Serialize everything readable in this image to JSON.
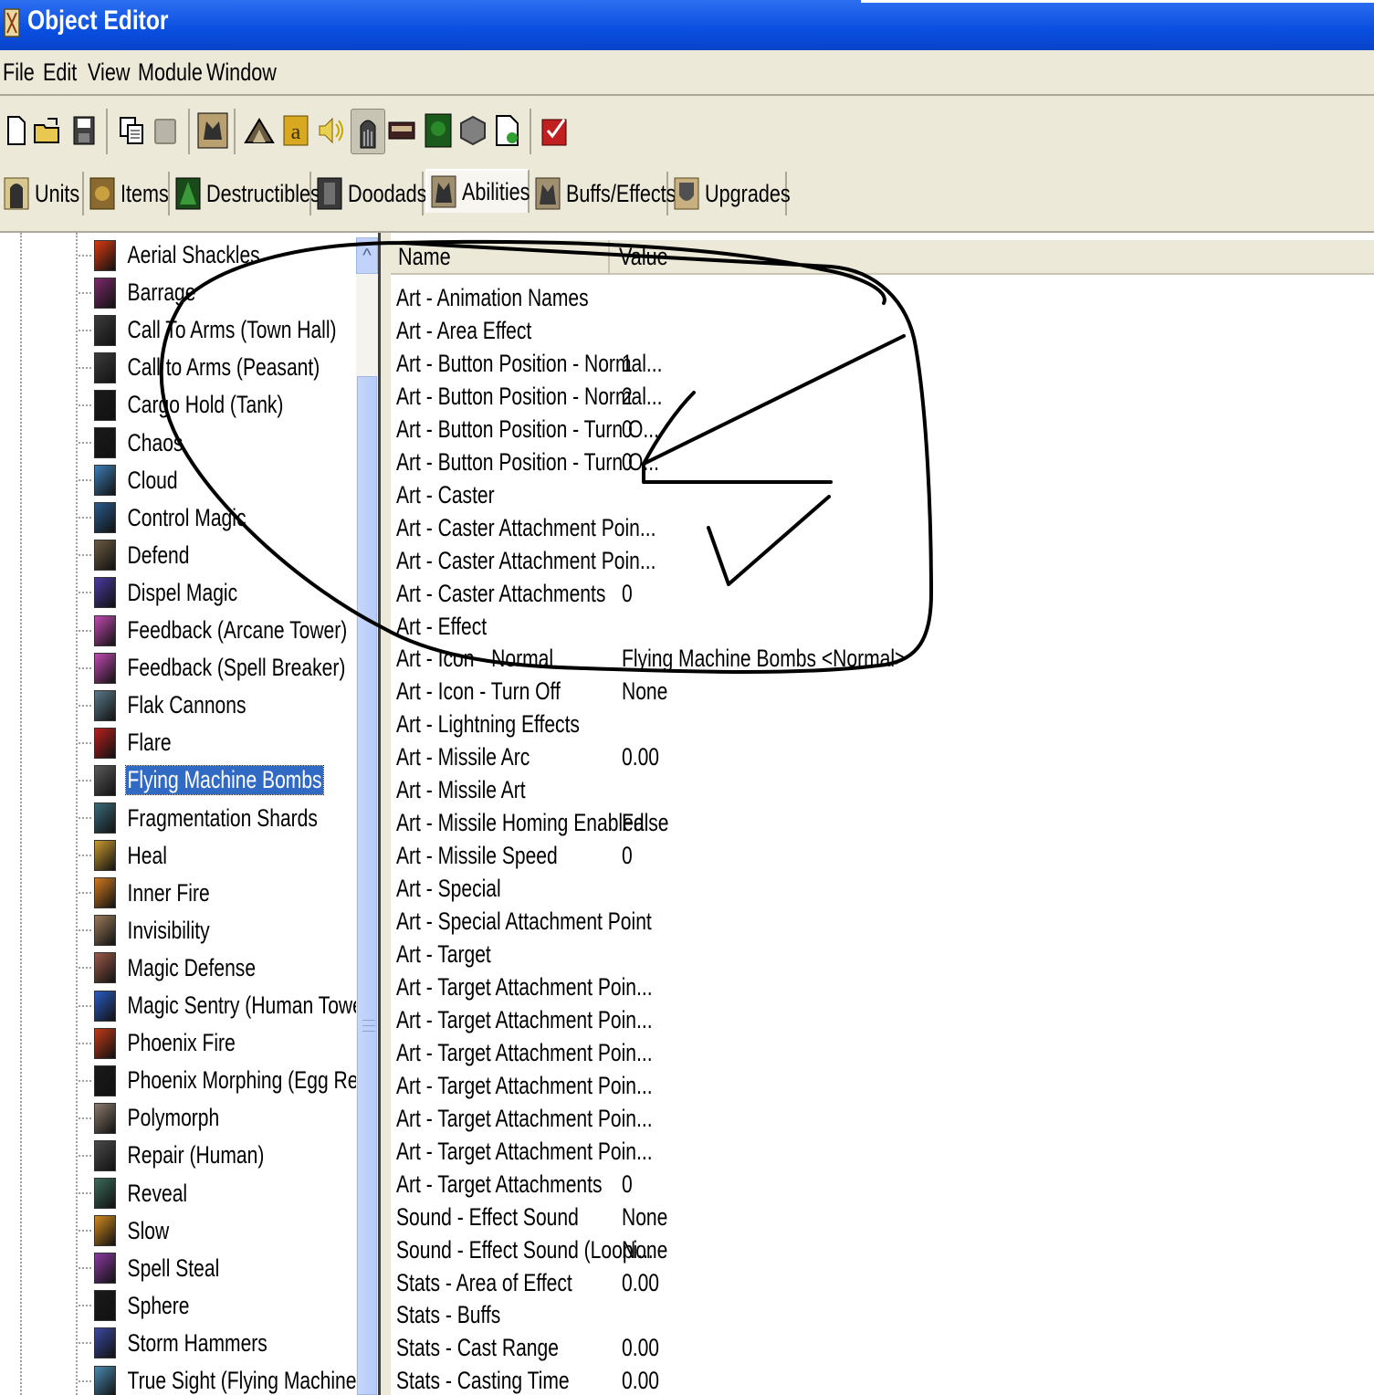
{
  "window": {
    "title": "Object Editor"
  },
  "menu": [
    "File",
    "Edit",
    "View",
    "Module",
    "Window"
  ],
  "toolbar": {
    "buttons": [
      "new-icon",
      "open-icon",
      "save-icon",
      "copy-icon",
      "paste-icon",
      "unit-editor-icon",
      "terrain-icon",
      "text-icon",
      "sound-icon",
      "object-icon",
      "camera-icon",
      "region-icon",
      "trigger-icon",
      "import-icon",
      "test-map-icon"
    ]
  },
  "tabs": [
    {
      "label": "Units",
      "icon": "units-icon"
    },
    {
      "label": "Items",
      "icon": "items-icon"
    },
    {
      "label": "Destructibles",
      "icon": "destructibles-icon"
    },
    {
      "label": "Doodads",
      "icon": "doodads-icon"
    },
    {
      "label": "Abilities",
      "icon": "abilities-icon",
      "active": true
    },
    {
      "label": "Buffs/Effects",
      "icon": "buffs-effects-icon"
    },
    {
      "label": "Upgrades",
      "icon": "upgrades-icon"
    }
  ],
  "tree": {
    "selected": "Flying Machine Bombs",
    "items": [
      {
        "label": "Aerial Shackles",
        "color": "#d83a12"
      },
      {
        "label": "Barrage",
        "color": "#7a2a6a"
      },
      {
        "label": "Call To Arms (Town Hall)",
        "color": "#3c3c3c"
      },
      {
        "label": "Call to Arms (Peasant)",
        "color": "#3c3c3c"
      },
      {
        "label": "Cargo Hold (Tank)",
        "color": "#1a1a1a"
      },
      {
        "label": "Chaos",
        "color": "#1a1a1a"
      },
      {
        "label": "Cloud",
        "color": "#3d7fb5"
      },
      {
        "label": "Control Magic",
        "color": "#2a5a8a"
      },
      {
        "label": "Defend",
        "color": "#6a5a40"
      },
      {
        "label": "Dispel Magic",
        "color": "#4a3aa0"
      },
      {
        "label": "Feedback (Arcane Tower)",
        "color": "#c04ab0"
      },
      {
        "label": "Feedback (Spell Breaker)",
        "color": "#c04ab0"
      },
      {
        "label": "Flak Cannons",
        "color": "#5a7a8a"
      },
      {
        "label": "Flare",
        "color": "#b82020"
      },
      {
        "label": "Flying Machine Bombs",
        "color": "#5a5a5a"
      },
      {
        "label": "Fragmentation Shards",
        "color": "#3a6a7a"
      },
      {
        "label": "Heal",
        "color": "#c89a30"
      },
      {
        "label": "Inner Fire",
        "color": "#d07a20"
      },
      {
        "label": "Invisibility",
        "color": "#9a7a5a"
      },
      {
        "label": "Magic Defense",
        "color": "#9a5a4a"
      },
      {
        "label": "Magic Sentry (Human Towers)",
        "color": "#2a5ac0"
      },
      {
        "label": "Phoenix Fire",
        "color": "#c03a1a"
      },
      {
        "label": "Phoenix Morphing (Egg Related)",
        "color": "#1a1a1a"
      },
      {
        "label": "Polymorph",
        "color": "#8a7a6a"
      },
      {
        "label": "Repair (Human)",
        "color": "#4a4a4a"
      },
      {
        "label": "Reveal",
        "color": "#3a6a5a"
      },
      {
        "label": "Slow",
        "color": "#d08a20"
      },
      {
        "label": "Spell Steal",
        "color": "#8a3aa0"
      },
      {
        "label": "Sphere",
        "color": "#1a1a1a"
      },
      {
        "label": "Storm Hammers",
        "color": "#3a4aa0"
      },
      {
        "label": "True Sight (Flying Machine)",
        "color": "#4a8ab0"
      }
    ]
  },
  "grid": {
    "columns": {
      "name": "Name",
      "value": "Value"
    },
    "rows": [
      {
        "name": "Art - Animation Names",
        "value": ""
      },
      {
        "name": "Art - Area Effect",
        "value": ""
      },
      {
        "name": "Art - Button Position - Normal...",
        "value": "1"
      },
      {
        "name": "Art - Button Position - Normal...",
        "value": "2"
      },
      {
        "name": "Art - Button Position - Turn O...",
        "value": "0"
      },
      {
        "name": "Art - Button Position - Turn O...",
        "value": "0"
      },
      {
        "name": "Art - Caster",
        "value": ""
      },
      {
        "name": "Art - Caster Attachment Poin...",
        "value": ""
      },
      {
        "name": "Art - Caster Attachment Poin...",
        "value": ""
      },
      {
        "name": "Art - Caster Attachments",
        "value": "0"
      },
      {
        "name": "Art - Effect",
        "value": ""
      },
      {
        "name": "Art - Icon - Normal",
        "value": "Flying Machine Bombs <Normal>"
      },
      {
        "name": "Art - Icon - Turn Off",
        "value": "None"
      },
      {
        "name": "Art - Lightning Effects",
        "value": ""
      },
      {
        "name": "Art - Missile Arc",
        "value": "0.00"
      },
      {
        "name": "Art - Missile Art",
        "value": ""
      },
      {
        "name": "Art - Missile Homing Enabled",
        "value": "False"
      },
      {
        "name": "Art - Missile Speed",
        "value": "0"
      },
      {
        "name": "Art - Special",
        "value": ""
      },
      {
        "name": "Art - Special Attachment Point",
        "value": ""
      },
      {
        "name": "Art - Target",
        "value": ""
      },
      {
        "name": "Art - Target Attachment Poin...",
        "value": ""
      },
      {
        "name": "Art - Target Attachment Poin...",
        "value": ""
      },
      {
        "name": "Art - Target Attachment Poin...",
        "value": ""
      },
      {
        "name": "Art - Target Attachment Poin...",
        "value": ""
      },
      {
        "name": "Art - Target Attachment Poin...",
        "value": ""
      },
      {
        "name": "Art - Target Attachment Poin...",
        "value": ""
      },
      {
        "name": "Art - Target Attachments",
        "value": "0"
      },
      {
        "name": "Sound - Effect Sound",
        "value": "None"
      },
      {
        "name": "Sound - Effect Sound (Loopi...",
        "value": "None"
      },
      {
        "name": "Stats - Area of Effect",
        "value": "0.00"
      },
      {
        "name": "Stats - Buffs",
        "value": ""
      },
      {
        "name": "Stats - Cast Range",
        "value": "0.00"
      },
      {
        "name": "Stats - Casting Time",
        "value": "0.00"
      }
    ]
  },
  "colors": {
    "titlebar": "#0a4fe0",
    "chrome": "#ece9d8",
    "selection": "#316ac5"
  }
}
